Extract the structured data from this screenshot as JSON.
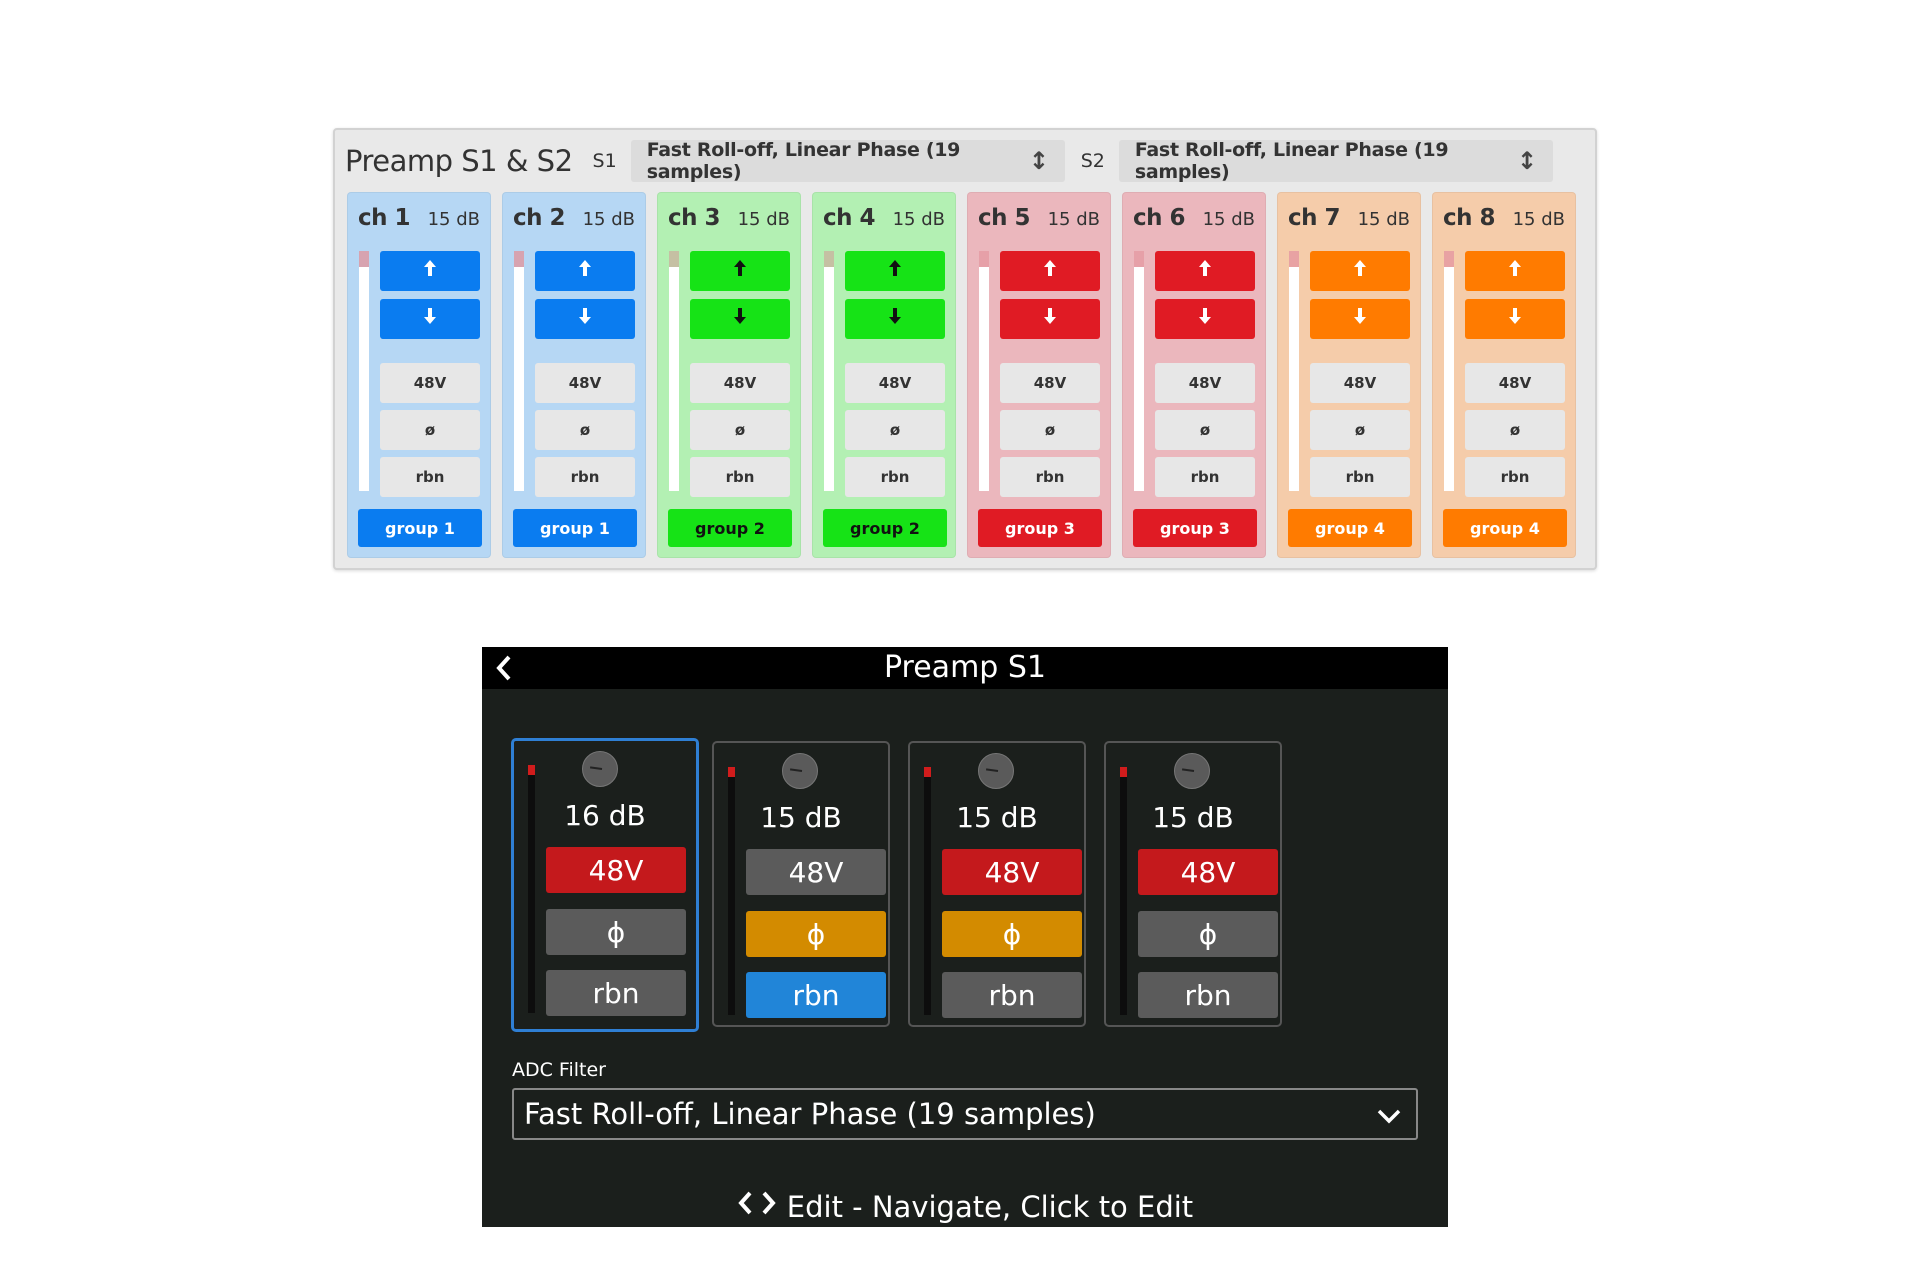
{
  "web": {
    "title": "Preamp S1 & S2",
    "s1_label": "S1",
    "s1_filter": "Fast Roll-off, Linear Phase (19 samples)",
    "s2_label": "S2",
    "s2_filter": "Fast Roll-off, Linear Phase (19 samples)",
    "updown_glyph": "↕",
    "channels": [
      {
        "name": "ch 1",
        "gain": "15 dB",
        "up": "🠕",
        "down": "🠗",
        "p48": "48V",
        "phase": "ø",
        "rbn": "rbn",
        "group": "group 1",
        "bg": "#b6d7f4",
        "accent": "#0a7cf0",
        "text": "#ffffff",
        "peak": "#d7a3b0"
      },
      {
        "name": "ch 2",
        "gain": "15 dB",
        "up": "🠕",
        "down": "🠗",
        "p48": "48V",
        "phase": "ø",
        "rbn": "rbn",
        "group": "group 1",
        "bg": "#b6d7f4",
        "accent": "#0a7cf0",
        "text": "#ffffff",
        "peak": "#d7a3b0"
      },
      {
        "name": "ch 3",
        "gain": "15 dB",
        "up": "🠕",
        "down": "🠗",
        "p48": "48V",
        "phase": "ø",
        "rbn": "rbn",
        "group": "group 2",
        "bg": "#b3f0b3",
        "accent": "#16e316",
        "text": "#111111",
        "peak": "#c5c0a3"
      },
      {
        "name": "ch 4",
        "gain": "15 dB",
        "up": "🠕",
        "down": "🠗",
        "p48": "48V",
        "phase": "ø",
        "rbn": "rbn",
        "group": "group 2",
        "bg": "#b3f0b3",
        "accent": "#16e316",
        "text": "#111111",
        "peak": "#c5c0a3"
      },
      {
        "name": "ch 5",
        "gain": "15 dB",
        "up": "🠕",
        "down": "🠗",
        "p48": "48V",
        "phase": "ø",
        "rbn": "rbn",
        "group": "group 3",
        "bg": "#ebb7bd",
        "accent": "#e01b24",
        "text": "#ffffff",
        "peak": "#e6a0a8"
      },
      {
        "name": "ch 6",
        "gain": "15 dB",
        "up": "🠕",
        "down": "🠗",
        "p48": "48V",
        "phase": "ø",
        "rbn": "rbn",
        "group": "group 3",
        "bg": "#ebb7bd",
        "accent": "#e01b24",
        "text": "#ffffff",
        "peak": "#e6a0a8"
      },
      {
        "name": "ch 7",
        "gain": "15 dB",
        "up": "🠕",
        "down": "🠗",
        "p48": "48V",
        "phase": "ø",
        "rbn": "rbn",
        "group": "group 4",
        "bg": "#f5ccaa",
        "accent": "#ff7b00",
        "text": "#ffffff",
        "peak": "#e8a2a3"
      },
      {
        "name": "ch 8",
        "gain": "15 dB",
        "up": "🠕",
        "down": "🠗",
        "p48": "48V",
        "phase": "ø",
        "rbn": "rbn",
        "group": "group 4",
        "bg": "#f5ccaa",
        "accent": "#ff7b00",
        "text": "#ffffff",
        "peak": "#e8a2a3"
      }
    ]
  },
  "device": {
    "title": "Preamp S1",
    "back_icon": "chevron-left-icon",
    "channels": [
      {
        "gain": "16 dB",
        "p48": "48V",
        "phase": "ϕ",
        "rbn": "rbn",
        "p48_state": "c-red",
        "phase_state": "c-gray",
        "rbn_state": "c-gray",
        "selected": true
      },
      {
        "gain": "15 dB",
        "p48": "48V",
        "phase": "ϕ",
        "rbn": "rbn",
        "p48_state": "c-gray",
        "phase_state": "c-amber",
        "rbn_state": "c-blue",
        "selected": false
      },
      {
        "gain": "15 dB",
        "p48": "48V",
        "phase": "ϕ",
        "rbn": "rbn",
        "p48_state": "c-red",
        "phase_state": "c-amber",
        "rbn_state": "c-gray",
        "selected": false
      },
      {
        "gain": "15 dB",
        "p48": "48V",
        "phase": "ϕ",
        "rbn": "rbn",
        "p48_state": "c-red",
        "phase_state": "c-gray",
        "rbn_state": "c-gray",
        "selected": false
      }
    ],
    "adc_label": "ADC Filter",
    "adc_value": "Fast Roll-off, Linear Phase (19 samples)",
    "footer_text": "Edit - Navigate, Click to Edit",
    "colors": {
      "selected_border": "#2f7fd4",
      "red": "#c4191c",
      "amber": "#d38b00",
      "blue": "#2185d8",
      "gray": "#5b5b5b"
    }
  }
}
